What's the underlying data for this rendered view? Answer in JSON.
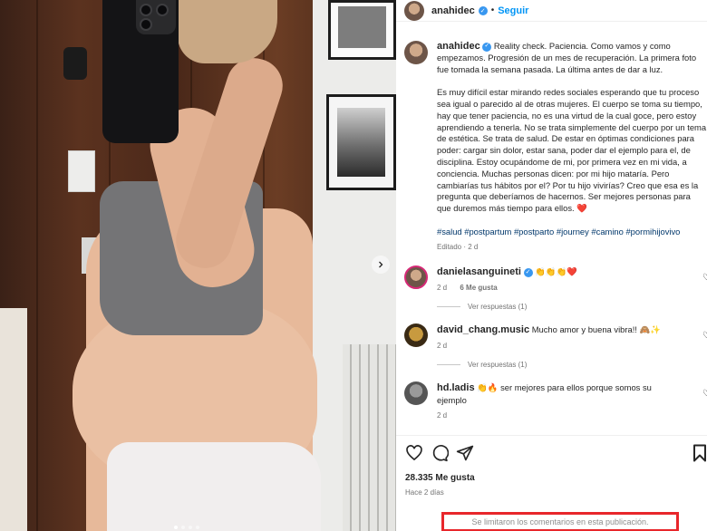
{
  "post": {
    "username": "anahidec",
    "follow_label": "Seguir",
    "caption_p1": "Reality check. Paciencia. Como vamos y como empezamos. Progresión de un mes de recuperación. La primera foto fue tomada la semana pasada. La última antes de dar a luz.",
    "caption_p2": "Es muy difícil estar mirando redes sociales esperando que tu proceso sea igual o parecido al de otras mujeres. El cuerpo se toma su tiempo, hay que tener paciencia, no es una virtud de la cual goce, pero estoy aprendiendo a tenerla. No se trata simplemente del cuerpo por un tema de estética. Se trata de salud. De estar en óptimas condiciones para poder: cargar sin dolor, estar sana, poder dar el ejemplo para el, de disciplina. Estoy ocupándome de mi, por primera vez en mi vida, a conciencia. Muchas personas dicen: por mi hijo mataría. Pero cambiarías tus hábitos por el? Por tu hijo vivirías? Creo que esa es la pregunta que deberíamos de hacernos. Ser mejores personas para que duremos más tiempo para ellos. ❤️",
    "hashtags": "#salud #postpartum #postparto #journey #camino #pormihijovivo",
    "edited": "Editado · 2 d"
  },
  "comments": [
    {
      "username": "danielasanguineti",
      "verified": true,
      "text": "👏👏👏❤️",
      "time": "2 d",
      "likes": "6 Me gusta",
      "replies": "Ver respuestas (1)"
    },
    {
      "username": "david_chang.music",
      "verified": false,
      "text": "Mucho amor y buena vibra!! 🙈✨",
      "time": "2 d",
      "replies": "Ver respuestas (1)"
    },
    {
      "username": "hd.ladis",
      "verified": false,
      "text": "👏🔥 ser mejores para ellos porque somos su ejemplo",
      "time": "2 d"
    }
  ],
  "footer": {
    "likes": "28.335 Me gusta",
    "ago": "Hace 2 días",
    "limited": "Se limitaron los comentarios en esta publicación."
  },
  "colors": {
    "link": "#0095f6",
    "verified": "#3897f0",
    "hashtag": "#00376b",
    "highlight": "#e8262b"
  },
  "icons": [
    "heart-icon",
    "comment-icon",
    "share-icon",
    "bookmark-icon",
    "verified-icon",
    "chevron-right-icon"
  ],
  "carousel": {
    "total": 4,
    "active": 1
  }
}
